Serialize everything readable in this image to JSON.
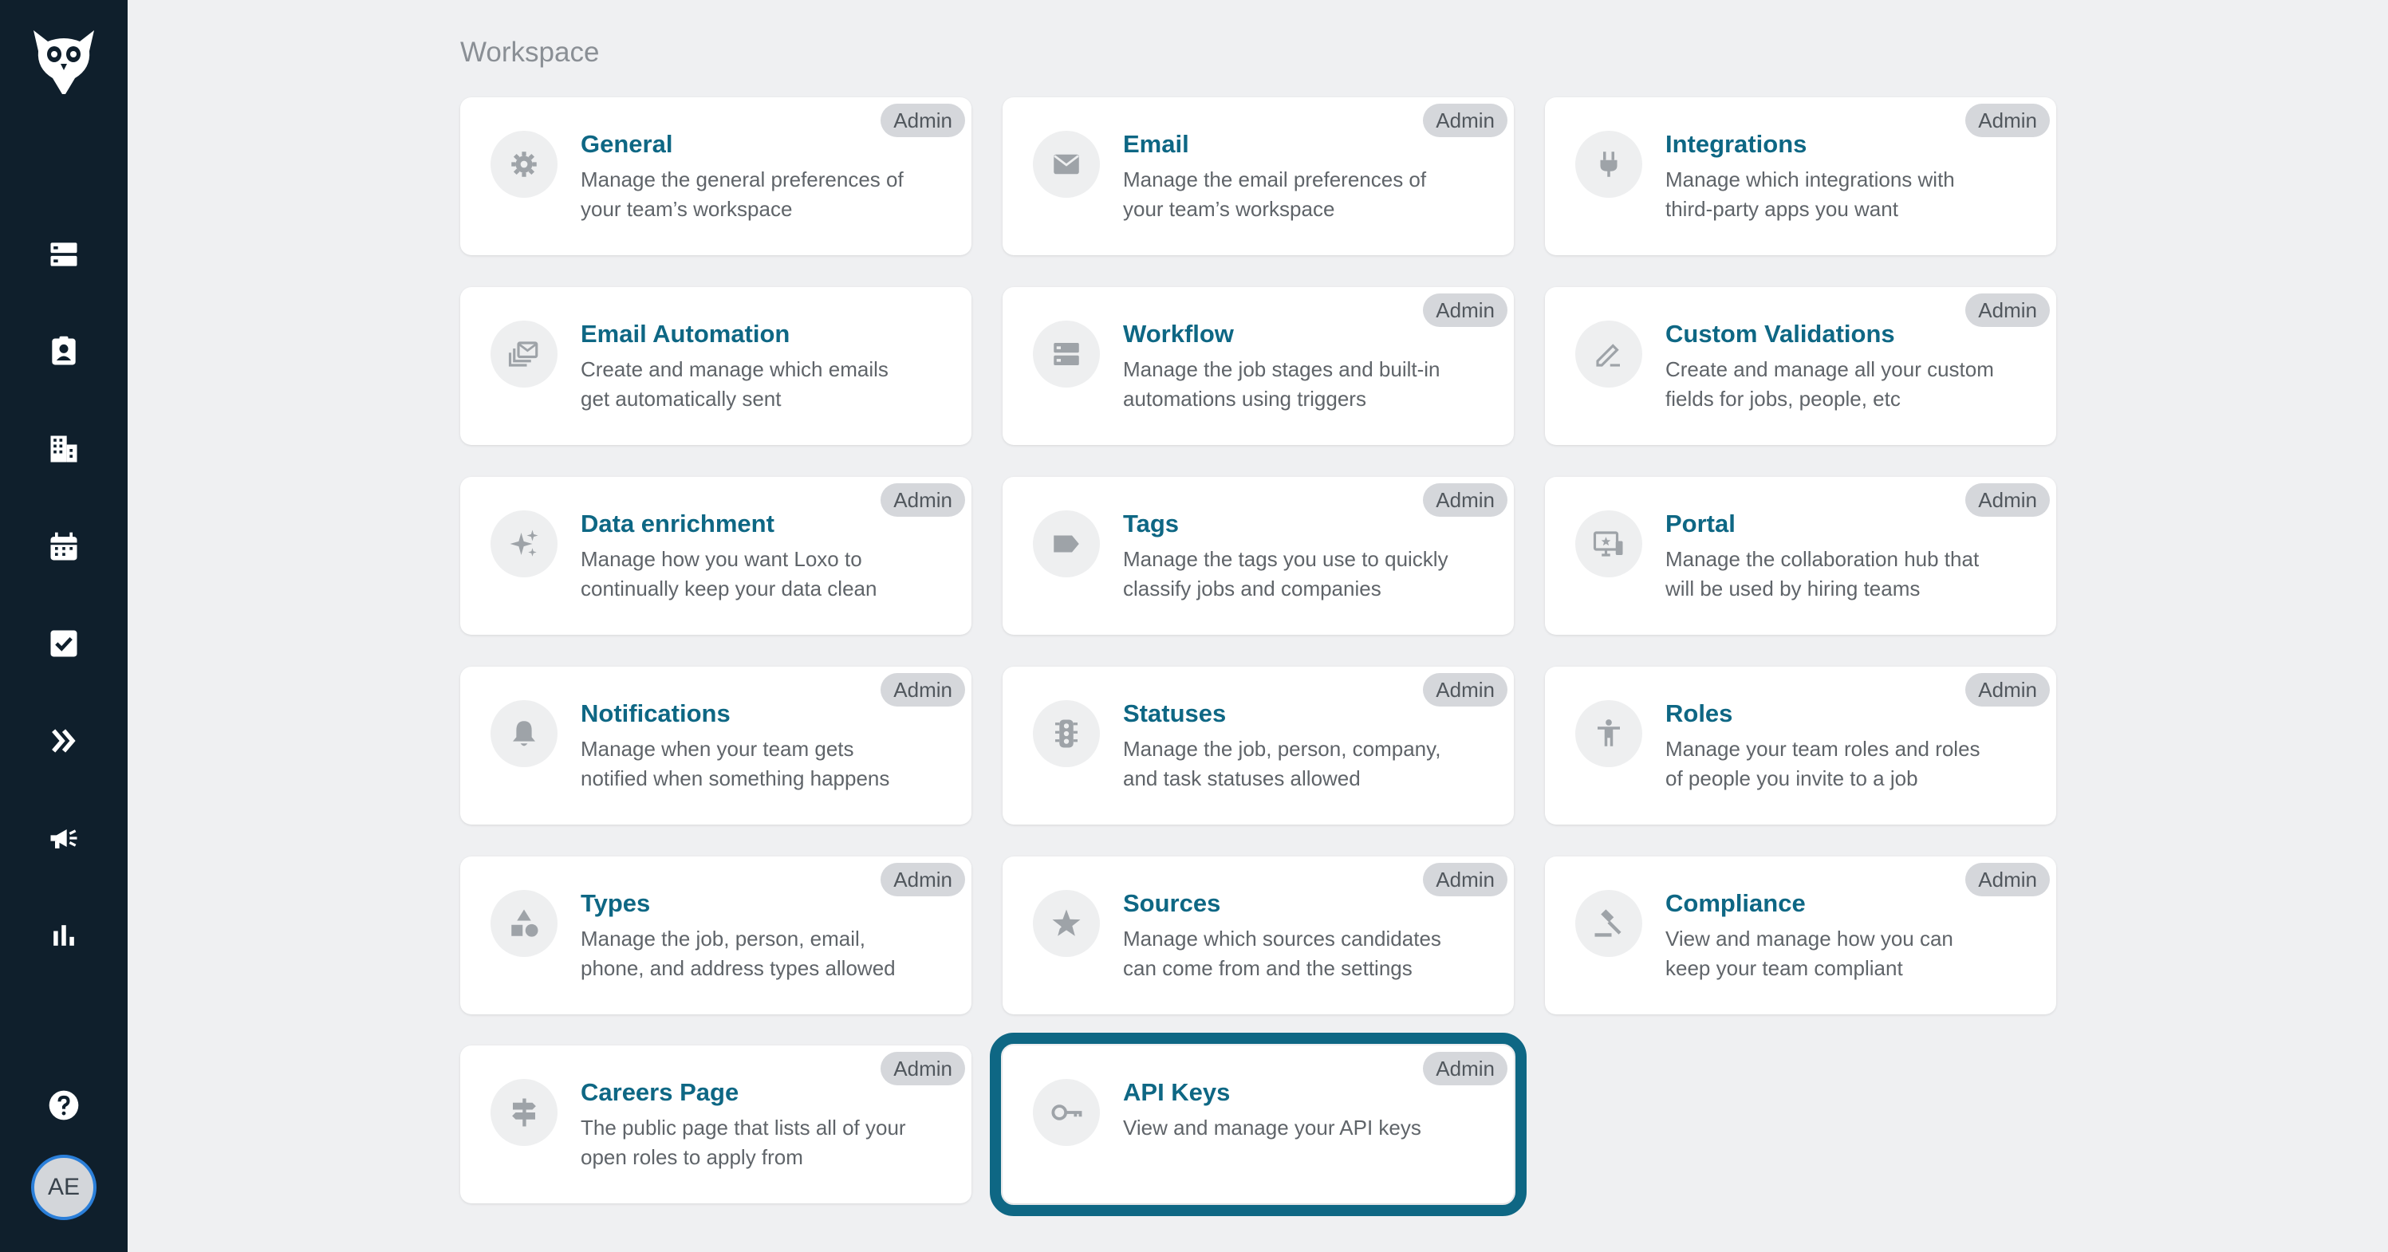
{
  "sidebar": {
    "avatar_initials": "AE",
    "nav": [
      {
        "name": "nav-jobs",
        "icon": "list-icon"
      },
      {
        "name": "nav-people",
        "icon": "contact-icon"
      },
      {
        "name": "nav-companies",
        "icon": "building-icon"
      },
      {
        "name": "nav-calendar",
        "icon": "calendar-icon"
      },
      {
        "name": "nav-tasks",
        "icon": "checkbox-icon"
      },
      {
        "name": "nav-sequences",
        "icon": "double-chevron-icon"
      },
      {
        "name": "nav-campaigns",
        "icon": "megaphone-icon"
      },
      {
        "name": "nav-reports",
        "icon": "bar-chart-icon"
      }
    ]
  },
  "page": {
    "section_title": "Workspace"
  },
  "cards": [
    {
      "icon": "gear-icon",
      "title": "General",
      "desc_line1": "Manage the general preferences of",
      "desc_line2": "your team’s workspace",
      "badge": "Admin"
    },
    {
      "icon": "envelope-icon",
      "title": "Email",
      "desc_line1": "Manage the email preferences of",
      "desc_line2": "your team’s workspace",
      "badge": "Admin"
    },
    {
      "icon": "plug-icon",
      "title": "Integrations",
      "desc_line1": "Manage which integrations with",
      "desc_line2": "third-party apps you want",
      "badge": "Admin"
    },
    {
      "icon": "stacked-mail-icon",
      "title": "Email Automation",
      "desc_line1": "Create and manage which emails",
      "desc_line2": "get automatically sent",
      "badge": ""
    },
    {
      "icon": "workflow-icon",
      "title": "Workflow",
      "desc_line1": "Manage the job stages and built-in",
      "desc_line2": "automations using triggers",
      "badge": "Admin"
    },
    {
      "icon": "pencil-icon",
      "title": "Custom Validations",
      "desc_line1": "Create and manage all your custom",
      "desc_line2": "fields for jobs, people, etc",
      "badge": "Admin"
    },
    {
      "icon": "sparkles-icon",
      "title": "Data enrichment",
      "desc_line1": "Manage how you want Loxo to",
      "desc_line2": "continually keep your data clean",
      "badge": "Admin"
    },
    {
      "icon": "tag-icon",
      "title": "Tags",
      "desc_line1": "Manage the tags you use to quickly",
      "desc_line2": "classify jobs and companies",
      "badge": "Admin"
    },
    {
      "icon": "portal-icon",
      "title": "Portal",
      "desc_line1": "Manage the collaboration hub that",
      "desc_line2": "will be used by hiring teams",
      "badge": "Admin"
    },
    {
      "icon": "bell-icon",
      "title": "Notifications",
      "desc_line1": "Manage when your team gets",
      "desc_line2": "notified when something happens",
      "badge": "Admin"
    },
    {
      "icon": "traffic-light-icon",
      "title": "Statuses",
      "desc_line1": "Manage the job, person, company,",
      "desc_line2": "and task statuses allowed",
      "badge": "Admin"
    },
    {
      "icon": "person-icon",
      "title": "Roles",
      "desc_line1": "Manage your team roles and roles",
      "desc_line2": "of people you invite to a job",
      "badge": "Admin"
    },
    {
      "icon": "shapes-icon",
      "title": "Types",
      "desc_line1": "Manage the job, person, email,",
      "desc_line2": "phone, and address types allowed",
      "badge": "Admin"
    },
    {
      "icon": "star-icon",
      "title": "Sources",
      "desc_line1": "Manage which sources candidates",
      "desc_line2": "can come from and the settings",
      "badge": "Admin"
    },
    {
      "icon": "gavel-icon",
      "title": "Compliance",
      "desc_line1": "View and manage how you can",
      "desc_line2": "keep your team compliant",
      "badge": "Admin"
    },
    {
      "icon": "signpost-icon",
      "title": "Careers Page",
      "desc_line1": "The public page that lists all of your",
      "desc_line2": "open roles to apply from",
      "badge": "Admin"
    },
    {
      "icon": "key-icon",
      "title": "API Keys",
      "desc_line1": "View and manage your API keys",
      "desc_line2": "",
      "badge": "Admin"
    }
  ]
}
